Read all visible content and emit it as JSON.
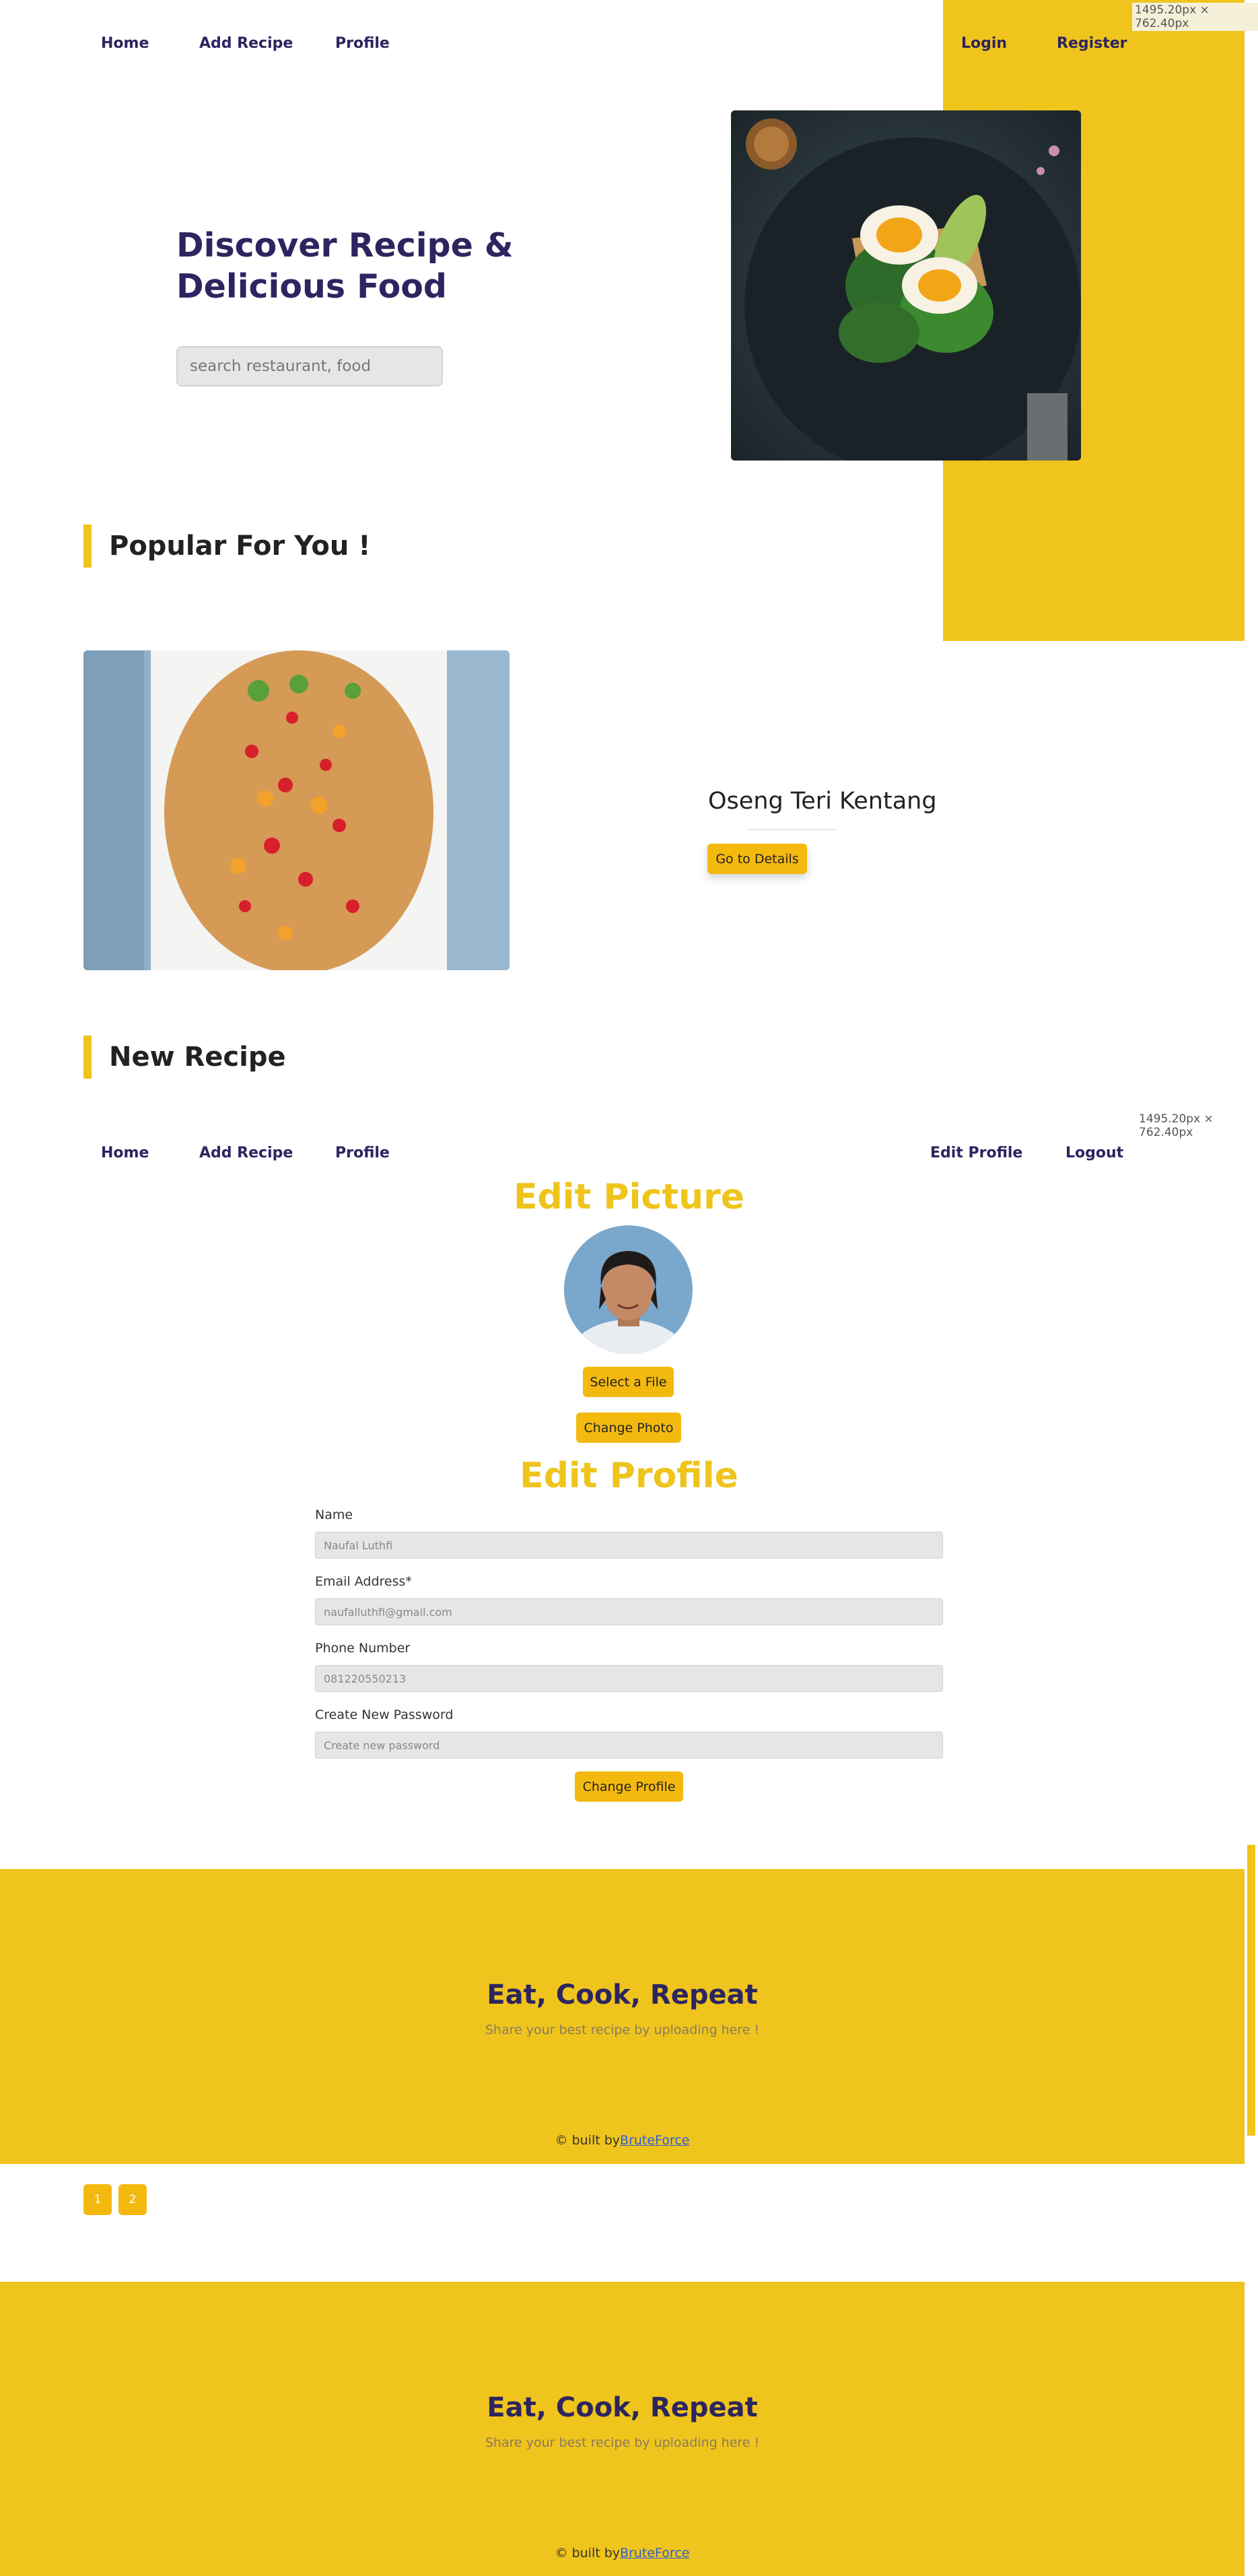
{
  "size_tags": [
    "1495.20px × 762.40px",
    "1495.20px × 762.40px"
  ],
  "nav_top": {
    "home": "Home",
    "add_recipe": "Add Recipe",
    "profile": "Profile",
    "login": "Login",
    "register": "Register"
  },
  "hero": {
    "title": "Discover Recipe & Delicious Food",
    "search_placeholder": "search restaurant, food"
  },
  "popular": {
    "title": "Popular For You !",
    "recipe_name": "Oseng Teri Kentang",
    "details_button": "Go to Details"
  },
  "new_recipe": {
    "title": "New Recipe"
  },
  "nav_profile": {
    "home": "Home",
    "add_recipe": "Add Recipe",
    "profile": "Profile",
    "edit_profile": "Edit Profile",
    "logout": "Logout"
  },
  "edit_picture": {
    "title": "Edit Picture",
    "select_file": "Select a File",
    "change_photo": "Change Photo"
  },
  "edit_profile": {
    "title": "Edit Profile",
    "name_label": "Name",
    "name_placeholder": "Naufal Luthfi",
    "email_label": "Email Address*",
    "email_placeholder": "naufalluthfi@gmail.com",
    "phone_label": "Phone Number",
    "phone_placeholder": "081220550213",
    "password_label": "Create New Password",
    "password_placeholder": "Create new password",
    "submit": "Change Profile"
  },
  "footer": {
    "title": "Eat, Cook, Repeat",
    "subtitle": "Share your best recipe by uploading here !",
    "built_prefix": "© built by",
    "built_link": "BruteForce"
  },
  "pagination": [
    "1",
    "2"
  ],
  "colors": {
    "accent_yellow": "#efc41c",
    "button_yellow": "#f4b90f",
    "navy": "#2c2560"
  }
}
